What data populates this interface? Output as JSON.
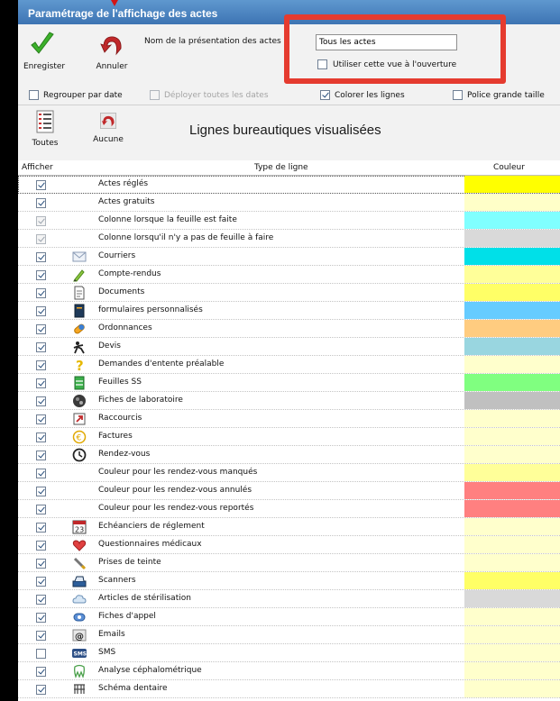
{
  "window": {
    "title": "Paramétrage de l'affichage des actes"
  },
  "toolbar": {
    "save_label": "Enregister",
    "cancel_label": "Annuler",
    "name_label": "Nom de la présentation des actes :",
    "name_value": "Tous les actes",
    "open_view_label": "Utiliser cette vue à l'ouverture",
    "open_view_checked": false
  },
  "options": {
    "group_by_date": {
      "label": "Regrouper par date",
      "checked": false,
      "enabled": true
    },
    "expand_all_dates": {
      "label": "Déployer toutes les dates",
      "checked": false,
      "enabled": false
    },
    "color_lines": {
      "label": "Colorer les lignes",
      "checked": true,
      "enabled": true
    },
    "large_font": {
      "label": "Police grande taille",
      "checked": false,
      "enabled": true
    }
  },
  "section": {
    "all_label": "Toutes",
    "none_label": "Aucune",
    "title": "Lignes bureautiques visualisées"
  },
  "grid": {
    "col_show": "Afficher",
    "col_type": "Type de ligne",
    "col_color": "Couleur",
    "rows": [
      {
        "checked": true,
        "enabled": true,
        "icon": "none",
        "label": "Actes réglés",
        "color": "#ffff00"
      },
      {
        "checked": true,
        "enabled": true,
        "icon": "none",
        "label": "Actes gratuits",
        "color": "#ffffc8"
      },
      {
        "checked": true,
        "enabled": false,
        "icon": "none",
        "label": "Colonne lorsque la feuille est faite",
        "color": "#80ffff"
      },
      {
        "checked": true,
        "enabled": false,
        "icon": "none",
        "label": "Colonne lorsqu'il n'y a pas de feuille à faire",
        "color": "#d9d9d9"
      },
      {
        "checked": true,
        "enabled": true,
        "icon": "envelope-icon",
        "label": "Courriers",
        "color": "#00e0e8"
      },
      {
        "checked": true,
        "enabled": true,
        "icon": "pencil-icon",
        "label": "Compte-rendus",
        "color": "#ffff99"
      },
      {
        "checked": true,
        "enabled": true,
        "icon": "document-icon",
        "label": "Documents",
        "color": "#ffff66"
      },
      {
        "checked": true,
        "enabled": true,
        "icon": "form-icon",
        "label": "formulaires personnalisés",
        "color": "#66ccff"
      },
      {
        "checked": true,
        "enabled": true,
        "icon": "pill-icon",
        "label": "Ordonnances",
        "color": "#ffcc80"
      },
      {
        "checked": true,
        "enabled": true,
        "icon": "devis-icon",
        "label": "Devis",
        "color": "#99d6e0"
      },
      {
        "checked": true,
        "enabled": true,
        "icon": "question-icon",
        "label": "Demandes d'entente préalable",
        "color": "#ffffcc"
      },
      {
        "checked": true,
        "enabled": true,
        "icon": "green-sheet-icon",
        "label": "Feuilles SS",
        "color": "#80ff80"
      },
      {
        "checked": true,
        "enabled": true,
        "icon": "lab-icon",
        "label": "Fiches de laboratoire",
        "color": "#c0c0c0"
      },
      {
        "checked": true,
        "enabled": true,
        "icon": "shortcut-icon",
        "label": "Raccourcis",
        "color": "#ffffcc"
      },
      {
        "checked": true,
        "enabled": true,
        "icon": "invoice-icon",
        "label": "Factures",
        "color": "#ffffcc"
      },
      {
        "checked": true,
        "enabled": true,
        "icon": "clock-icon",
        "label": "Rendez-vous",
        "color": "#ffffcc"
      },
      {
        "checked": true,
        "enabled": true,
        "icon": "none",
        "label": "Couleur pour les rendez-vous manqués",
        "color": "#ffff99"
      },
      {
        "checked": true,
        "enabled": true,
        "icon": "none",
        "label": "Couleur pour les rendez-vous annulés",
        "color": "#ff8080"
      },
      {
        "checked": true,
        "enabled": true,
        "icon": "none",
        "label": "Couleur pour les rendez-vous reportés",
        "color": "#ff8080"
      },
      {
        "checked": true,
        "enabled": true,
        "icon": "calendar-icon",
        "label": "Echéanciers de réglement",
        "color": "#ffffcc"
      },
      {
        "checked": true,
        "enabled": true,
        "icon": "heart-icon",
        "label": "Questionnaires médicaux",
        "color": "#ffffcc"
      },
      {
        "checked": true,
        "enabled": true,
        "icon": "brush-icon",
        "label": "Prises de teinte",
        "color": "#ffffcc"
      },
      {
        "checked": true,
        "enabled": true,
        "icon": "scanner-icon",
        "label": "Scanners",
        "color": "#ffff66"
      },
      {
        "checked": true,
        "enabled": true,
        "icon": "cloud-icon",
        "label": "Articles de stérilisation",
        "color": "#d9d9d9"
      },
      {
        "checked": true,
        "enabled": true,
        "icon": "phone-icon",
        "label": "Fiches d'appel",
        "color": "#ffffcc"
      },
      {
        "checked": true,
        "enabled": true,
        "icon": "email-icon",
        "label": "Emails",
        "color": "#ffffcc"
      },
      {
        "checked": false,
        "enabled": true,
        "icon": "sms-icon",
        "label": "SMS",
        "color": "#ffffcc"
      },
      {
        "checked": true,
        "enabled": true,
        "icon": "tooth-icon",
        "label": "Analyse céphalométrique",
        "color": "#ffffcc"
      },
      {
        "checked": true,
        "enabled": true,
        "icon": "teeth-icon",
        "label": "Schéma dentaire",
        "color": "#ffffcc"
      }
    ]
  }
}
